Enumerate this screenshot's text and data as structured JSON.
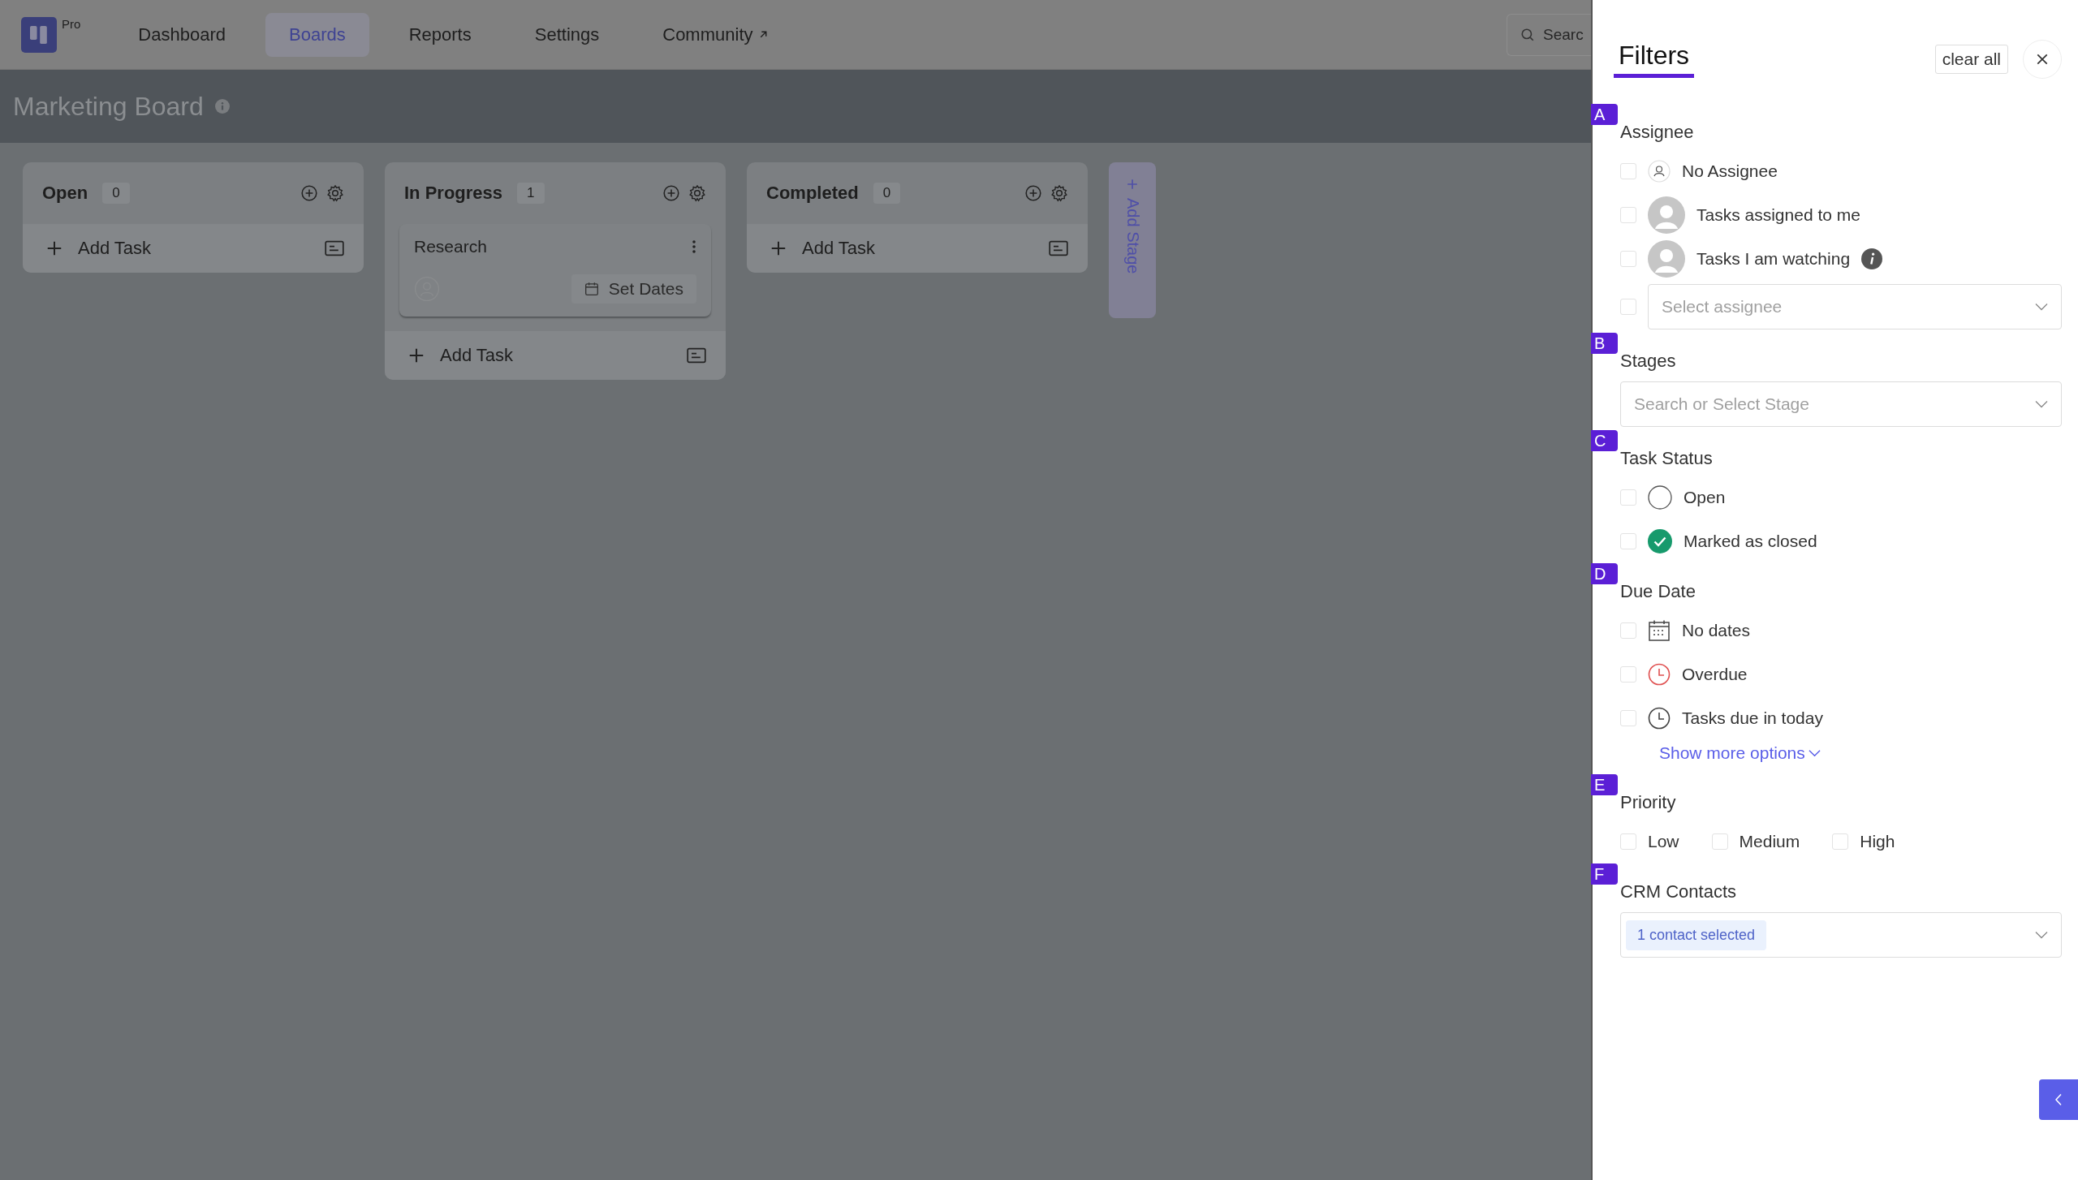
{
  "nav": {
    "logo_badge": "Pro",
    "items": [
      {
        "label": "Dashboard",
        "selected": false,
        "external": false
      },
      {
        "label": "Boards",
        "selected": true,
        "external": false
      },
      {
        "label": "Reports",
        "selected": false,
        "external": false
      },
      {
        "label": "Settings",
        "selected": false,
        "external": false
      },
      {
        "label": "Community",
        "selected": false,
        "external": true
      }
    ],
    "search": {
      "placeholder": "Searc"
    }
  },
  "board": {
    "title": "Marketing Board",
    "columns": [
      {
        "title": "Open",
        "count": "0",
        "add_label": "Add Task"
      },
      {
        "title": "In Progress",
        "count": "1",
        "tasks": [
          {
            "title": "Research",
            "action": "Set Dates"
          }
        ],
        "add_label": "Add Task"
      },
      {
        "title": "Completed",
        "count": "0",
        "add_label": "Add Task"
      }
    ],
    "add_stage": "Add Stage"
  },
  "filters": {
    "title": "Filters",
    "clear_all": "clear all",
    "sections": [
      {
        "letter": "A",
        "title": "Assignee",
        "inline": false,
        "items": [
          {
            "kind": "option",
            "label": "No Assignee",
            "checked": false,
            "info": false
          },
          {
            "kind": "option",
            "label": "Tasks assigned to me",
            "checked": false,
            "info": false
          },
          {
            "kind": "option",
            "label": "Tasks I am watching",
            "checked": false,
            "info": true
          },
          {
            "kind": "select",
            "placeholder": "Select assignee",
            "checked": false
          }
        ]
      },
      {
        "letter": "B",
        "title": "Stages",
        "inline": false,
        "items": [
          {
            "kind": "select",
            "placeholder": "Search or Select Stage"
          }
        ]
      },
      {
        "letter": "C",
        "title": "Task Status",
        "inline": false,
        "items": [
          {
            "kind": "option",
            "label": "Open",
            "checked": false,
            "info": false
          },
          {
            "kind": "option",
            "label": "Marked as closed",
            "checked": false,
            "info": false
          }
        ]
      },
      {
        "letter": "D",
        "title": "Due Date",
        "inline": false,
        "items": [
          {
            "kind": "option",
            "label": "No dates",
            "checked": false,
            "info": false
          },
          {
            "kind": "option",
            "label": "Overdue",
            "checked": false,
            "info": false
          },
          {
            "kind": "option",
            "label": "Tasks due in today",
            "checked": false,
            "info": false
          },
          {
            "kind": "link",
            "label": "Show more options"
          }
        ]
      },
      {
        "letter": "E",
        "title": "Priority",
        "inline": true,
        "items": [
          {
            "kind": "option",
            "label": "Low",
            "checked": false,
            "info": false
          },
          {
            "kind": "option",
            "label": "Medium",
            "checked": false,
            "info": false
          },
          {
            "kind": "option",
            "label": "High",
            "checked": false,
            "info": false
          }
        ]
      },
      {
        "letter": "F",
        "title": "CRM Contacts",
        "inline": false,
        "items": [
          {
            "kind": "select",
            "value": "1 contact selected"
          }
        ]
      }
    ]
  }
}
